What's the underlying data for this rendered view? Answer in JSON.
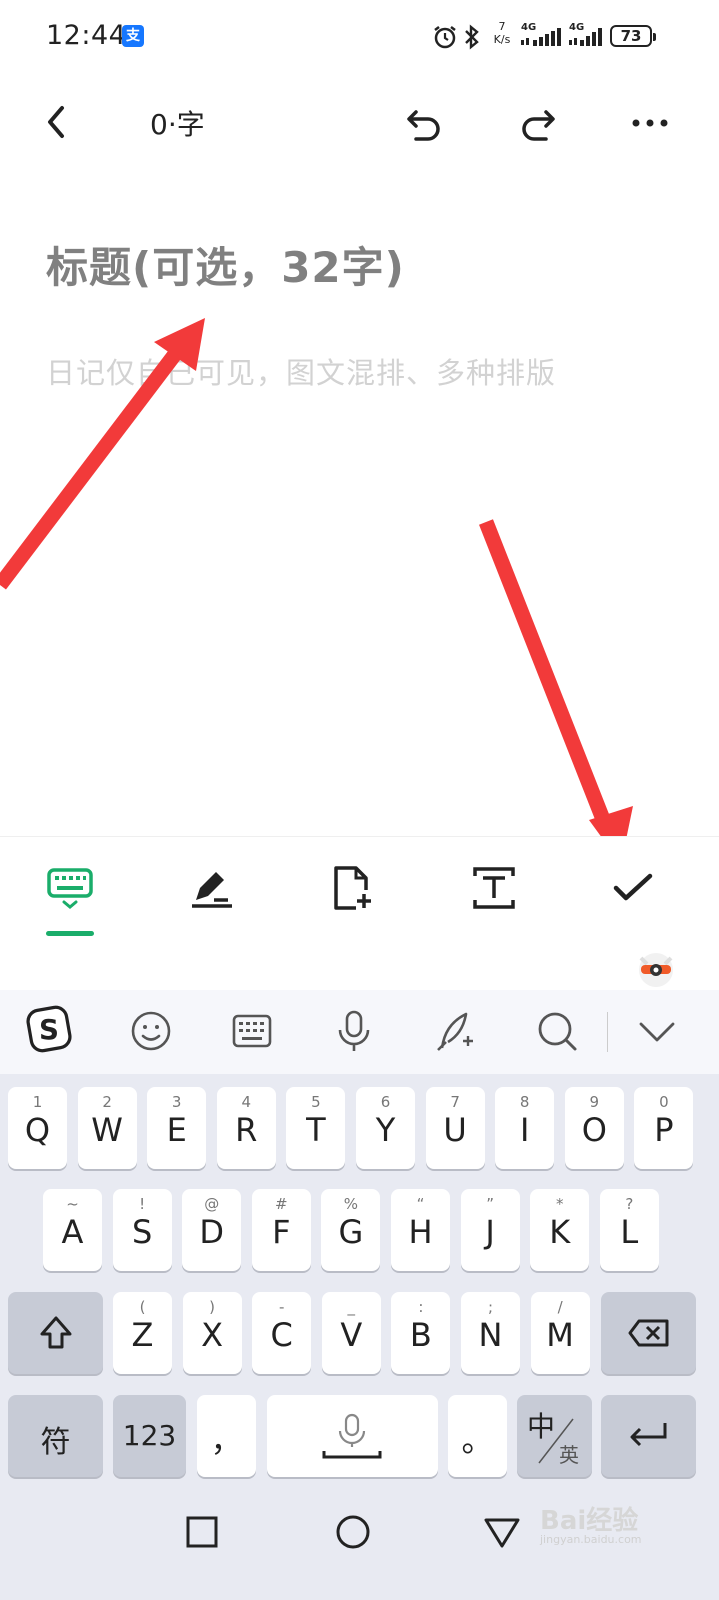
{
  "status_bar": {
    "time": "12:44",
    "alipay_icon": "alipay-icon",
    "net_speed_value": "7",
    "net_speed_unit": "K/s",
    "network1": "4G",
    "network2": "4G",
    "battery": "73"
  },
  "topbar": {
    "word_count": "0·字",
    "icons": [
      "back-icon",
      "undo-icon",
      "redo-icon",
      "more-icon"
    ]
  },
  "editor": {
    "title_placeholder": "标题(可选，32字)",
    "body_placeholder": "日记仅自己可见，图文混排、多种排版"
  },
  "edit_toolbar": {
    "icons": [
      "keyboard-icon",
      "pen-icon",
      "add-file-icon",
      "text-format-icon",
      "check-icon"
    ],
    "active_color": "#1aad6a"
  },
  "ime_toolbar": {
    "icons": [
      "sogou-logo-icon",
      "emoji-icon",
      "keyboard-layout-icon",
      "microphone-icon",
      "handwriting-icon",
      "search-icon",
      "collapse-icon"
    ]
  },
  "keyboard": {
    "row1": [
      {
        "sub": "1",
        "key": "Q"
      },
      {
        "sub": "2",
        "key": "W"
      },
      {
        "sub": "3",
        "key": "E"
      },
      {
        "sub": "4",
        "key": "R"
      },
      {
        "sub": "5",
        "key": "T"
      },
      {
        "sub": "6",
        "key": "Y"
      },
      {
        "sub": "7",
        "key": "U"
      },
      {
        "sub": "8",
        "key": "I"
      },
      {
        "sub": "9",
        "key": "O"
      },
      {
        "sub": "0",
        "key": "P"
      }
    ],
    "row2": [
      {
        "sub": "~",
        "key": "A"
      },
      {
        "sub": "!",
        "key": "S"
      },
      {
        "sub": "@",
        "key": "D"
      },
      {
        "sub": "#",
        "key": "F"
      },
      {
        "sub": "%",
        "key": "G"
      },
      {
        "sub": "“",
        "key": "H"
      },
      {
        "sub": "”",
        "key": "J"
      },
      {
        "sub": "*",
        "key": "K"
      },
      {
        "sub": "?",
        "key": "L"
      }
    ],
    "row3": [
      {
        "sub": "(",
        "key": "Z"
      },
      {
        "sub": ")",
        "key": "X"
      },
      {
        "sub": "-",
        "key": "C"
      },
      {
        "sub": "_",
        "key": "V"
      },
      {
        "sub": ":",
        "key": "B"
      },
      {
        "sub": ";",
        "key": "N"
      },
      {
        "sub": "/",
        "key": "M"
      }
    ],
    "symbols_label": "符",
    "numbers_label": "123",
    "comma_label": "，",
    "period_label": "。",
    "lang_main": "中",
    "lang_alt": "英"
  },
  "navbar": {
    "icons": [
      "recent-apps-icon",
      "home-icon",
      "back-nav-icon"
    ]
  },
  "watermark": {
    "text": "Bai经验",
    "url": "jingyan.baidu.com"
  }
}
